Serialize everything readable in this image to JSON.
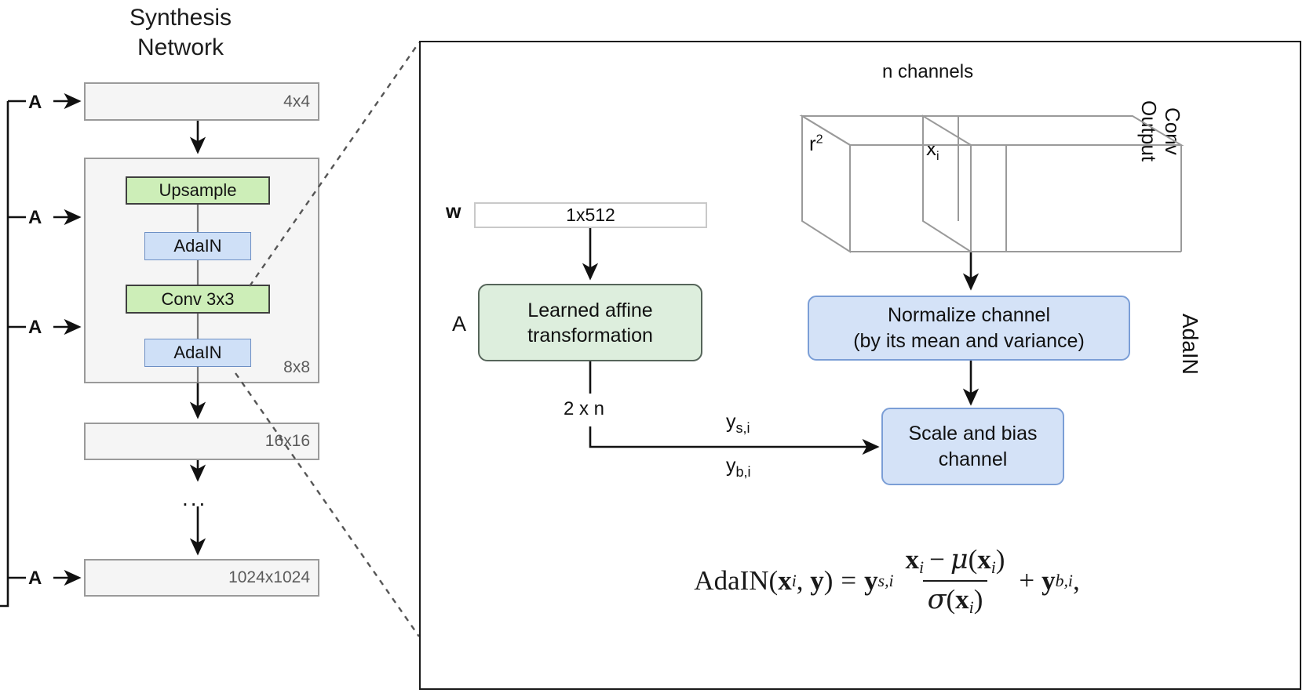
{
  "figure": {
    "title": "StyleGAN AdaIN architecture diagram"
  },
  "synthesis_network": {
    "title_line1": "Synthesis",
    "title_line2": "Network",
    "resolution_blocks": [
      {
        "id": "4x4",
        "label": "4x4"
      },
      {
        "id": "8x8",
        "label": "8x8"
      },
      {
        "id": "16x16",
        "label": "16x16"
      },
      {
        "id": "1024x1024",
        "label": "1024x1024"
      }
    ],
    "inner_blocks": [
      {
        "id": "upsample",
        "label": "Upsample",
        "color": "#cdeeb8"
      },
      {
        "id": "adain-1",
        "label": "AdaIN",
        "color": "#cfe0f7"
      },
      {
        "id": "conv",
        "label": "Conv 3x3",
        "color": "#cdeeb8"
      },
      {
        "id": "adain-2",
        "label": "AdaIN",
        "color": "#cfe0f7"
      }
    ],
    "ellipsis": "...",
    "a_inputs": [
      {
        "label": "A"
      },
      {
        "label": "A"
      },
      {
        "label": "A"
      },
      {
        "label": "A"
      }
    ]
  },
  "detail_panel": {
    "side_label": "AdaIN",
    "conv_output_label_line1": "Conv",
    "conv_output_label_line2": "Output",
    "n_channels_label": "n channels",
    "cube_r2_label": "r",
    "cube_r2_exponent": "2",
    "cube_xi_label": "x",
    "cube_xi_subscript": "i",
    "w_label": "w",
    "w_box_label": "1x512",
    "a_label": "A",
    "affine_line1": "Learned affine",
    "affine_line2": "transformation",
    "two_x_n_label": "2 x n",
    "ys_i_label": "y",
    "ys_i_sub": "s,i",
    "yb_i_label": "y",
    "yb_i_sub": "b,i",
    "normalize_line1": "Normalize channel",
    "normalize_line2": "(by its mean and variance)",
    "scale_line1": "Scale and bias",
    "scale_line2": "channel"
  },
  "equation": {
    "lhs_name": "AdaIN",
    "lhs_arg1": "x",
    "lhs_arg1_sub": "i",
    "lhs_arg2": "y",
    "equals": "=",
    "scale_sym": "y",
    "scale_sub": "s,i",
    "numerator_x": "x",
    "numerator_x_sub": "i",
    "minus": "−",
    "mu": "μ",
    "mu_arg": "x",
    "mu_arg_sub": "i",
    "sigma": "σ",
    "sigma_arg": "x",
    "sigma_arg_sub": "i",
    "plus": "+",
    "bias_sym": "y",
    "bias_sub": "b,i",
    "trailing_comma": ","
  },
  "colors": {
    "green_fill": "#cdeeb8",
    "blue_fill": "#cfe0f7",
    "grey_fill": "#f5f5f5",
    "affine_fill": "#ddeedd",
    "normalize_fill": "#d4e2f7",
    "border_dark": "#1b1b1b",
    "border_grey": "#9a9a9a"
  }
}
